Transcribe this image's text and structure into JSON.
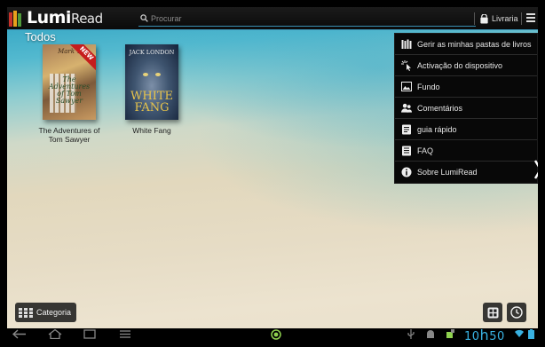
{
  "app": {
    "logo_bold": "Lumi",
    "logo_light": "Read"
  },
  "search": {
    "placeholder": "Procurar"
  },
  "toolbar": {
    "store_label": "Livraria"
  },
  "library": {
    "section_title": "Todos",
    "books": [
      {
        "label": "The Adventures of Tom Sawyer",
        "cover_author": "Mark T",
        "cover_title": "The Adventures of Tom Sawyer",
        "badge": "NEW"
      },
      {
        "label": "White Fang",
        "cover_author": "JACK LONDON",
        "cover_title": "WHITE FANG"
      }
    ]
  },
  "menu": {
    "items": [
      {
        "label": "Gerir as minhas pastas de livros",
        "icon": "bookshelf-icon"
      },
      {
        "label": "Activação do dispositivo",
        "icon": "activation-cursor-icon"
      },
      {
        "label": "Fundo",
        "icon": "image-icon"
      },
      {
        "label": "Comentários",
        "icon": "users-icon"
      },
      {
        "label": "guia rápido",
        "icon": "guide-icon"
      },
      {
        "label": "FAQ",
        "icon": "faq-icon"
      },
      {
        "label": "Sobre LumiRead",
        "icon": "info-icon"
      }
    ]
  },
  "bottom": {
    "category_label": "Categoria"
  },
  "status": {
    "clock_hours": "10",
    "clock_h": "h",
    "clock_minutes": "50"
  },
  "colors": {
    "accent": "#39b2e2",
    "topbar": "#111111",
    "menu_bg": "#080808"
  }
}
